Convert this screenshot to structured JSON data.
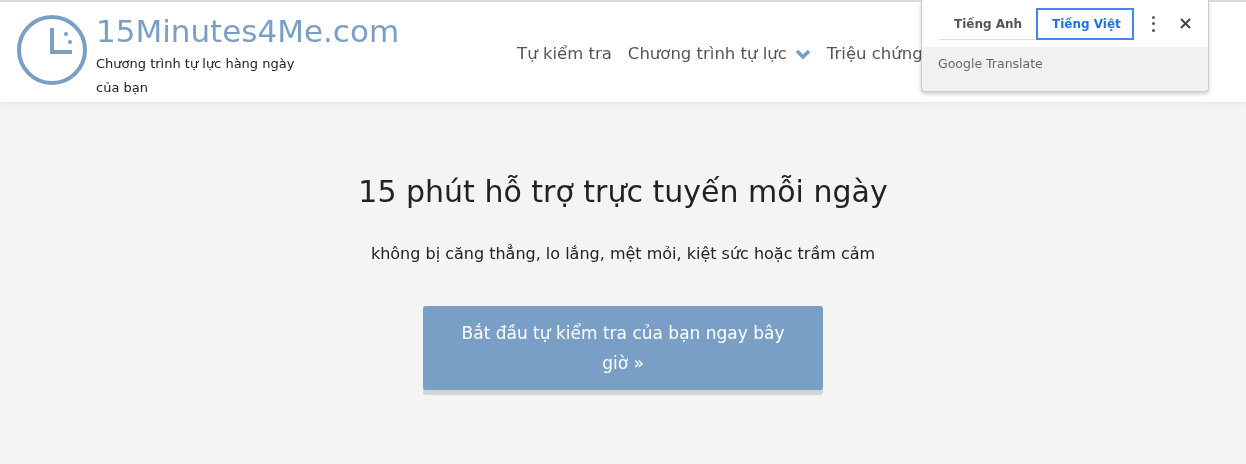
{
  "site": {
    "title": "15Minutes4Me.com",
    "tagline": "Chương trình tự lực hàng ngày của bạn"
  },
  "nav": [
    {
      "label": "Tự kiểm tra",
      "dropdown": false
    },
    {
      "label": "Chương trình tự lực",
      "dropdown": true
    },
    {
      "label": "Triệu chứng",
      "dropdown": false
    }
  ],
  "translate_popup": {
    "languages": [
      {
        "label": "Tiếng Anh",
        "selected": false
      },
      {
        "label": "Tiếng Việt",
        "selected": true
      }
    ],
    "footer": "Google Translate"
  },
  "hero": {
    "heading": "15 phút hỗ trợ trực tuyến mỗi ngày",
    "subtitle": "không bị căng thẳng, lo lắng, mệt mỏi, kiệt sức hoặc trầm cảm",
    "button": "Bắt đầu tự kiểm tra của bạn ngay bây giờ »"
  }
}
